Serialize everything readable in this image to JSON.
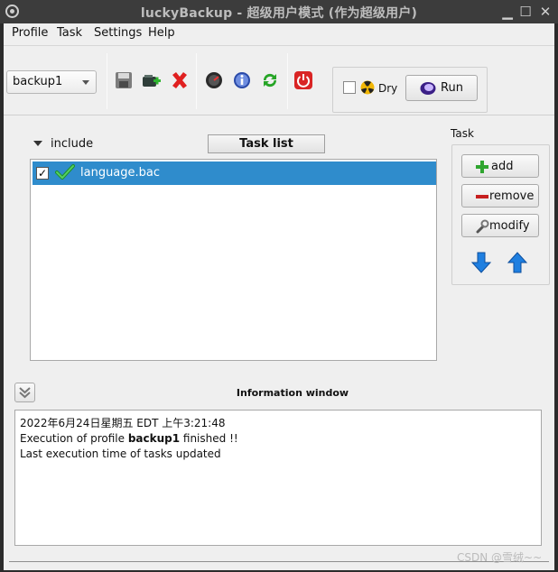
{
  "window": {
    "title": "luckyBackup - 超级用户模式 (作为超级用户)"
  },
  "menubar": {
    "items": [
      "Profile",
      "Task",
      "Settings",
      "Help"
    ]
  },
  "toolbar": {
    "profile_value": "backup1",
    "dry_label": "Dry",
    "dry_checked": false,
    "run_label": "Run",
    "icons": [
      "save-icon",
      "new-profile-icon",
      "delete-icon",
      "schedule-icon",
      "info-icon",
      "refresh-icon",
      "shutdown-icon"
    ]
  },
  "tasks": {
    "include_label": "include",
    "header": "Task list",
    "items": [
      {
        "name": "language.bac",
        "checked": true,
        "status": "ok"
      }
    ]
  },
  "side": {
    "label": "Task",
    "add": "add",
    "remove": "remove",
    "modify": "modify"
  },
  "info": {
    "title": "Information window",
    "line1": "2022年6月24日星期五 EDT 上午3:21:48",
    "line2_prefix": "Execution of profile ",
    "line2_bold": "backup1",
    "line2_suffix": " finished !!",
    "line3": "Last execution time of tasks updated"
  },
  "watermark": "CSDN @雪绒~~",
  "colors": {
    "selection": "#2f8ccc",
    "titlebar": "#3c3c3c",
    "window_bg": "#efefef"
  }
}
